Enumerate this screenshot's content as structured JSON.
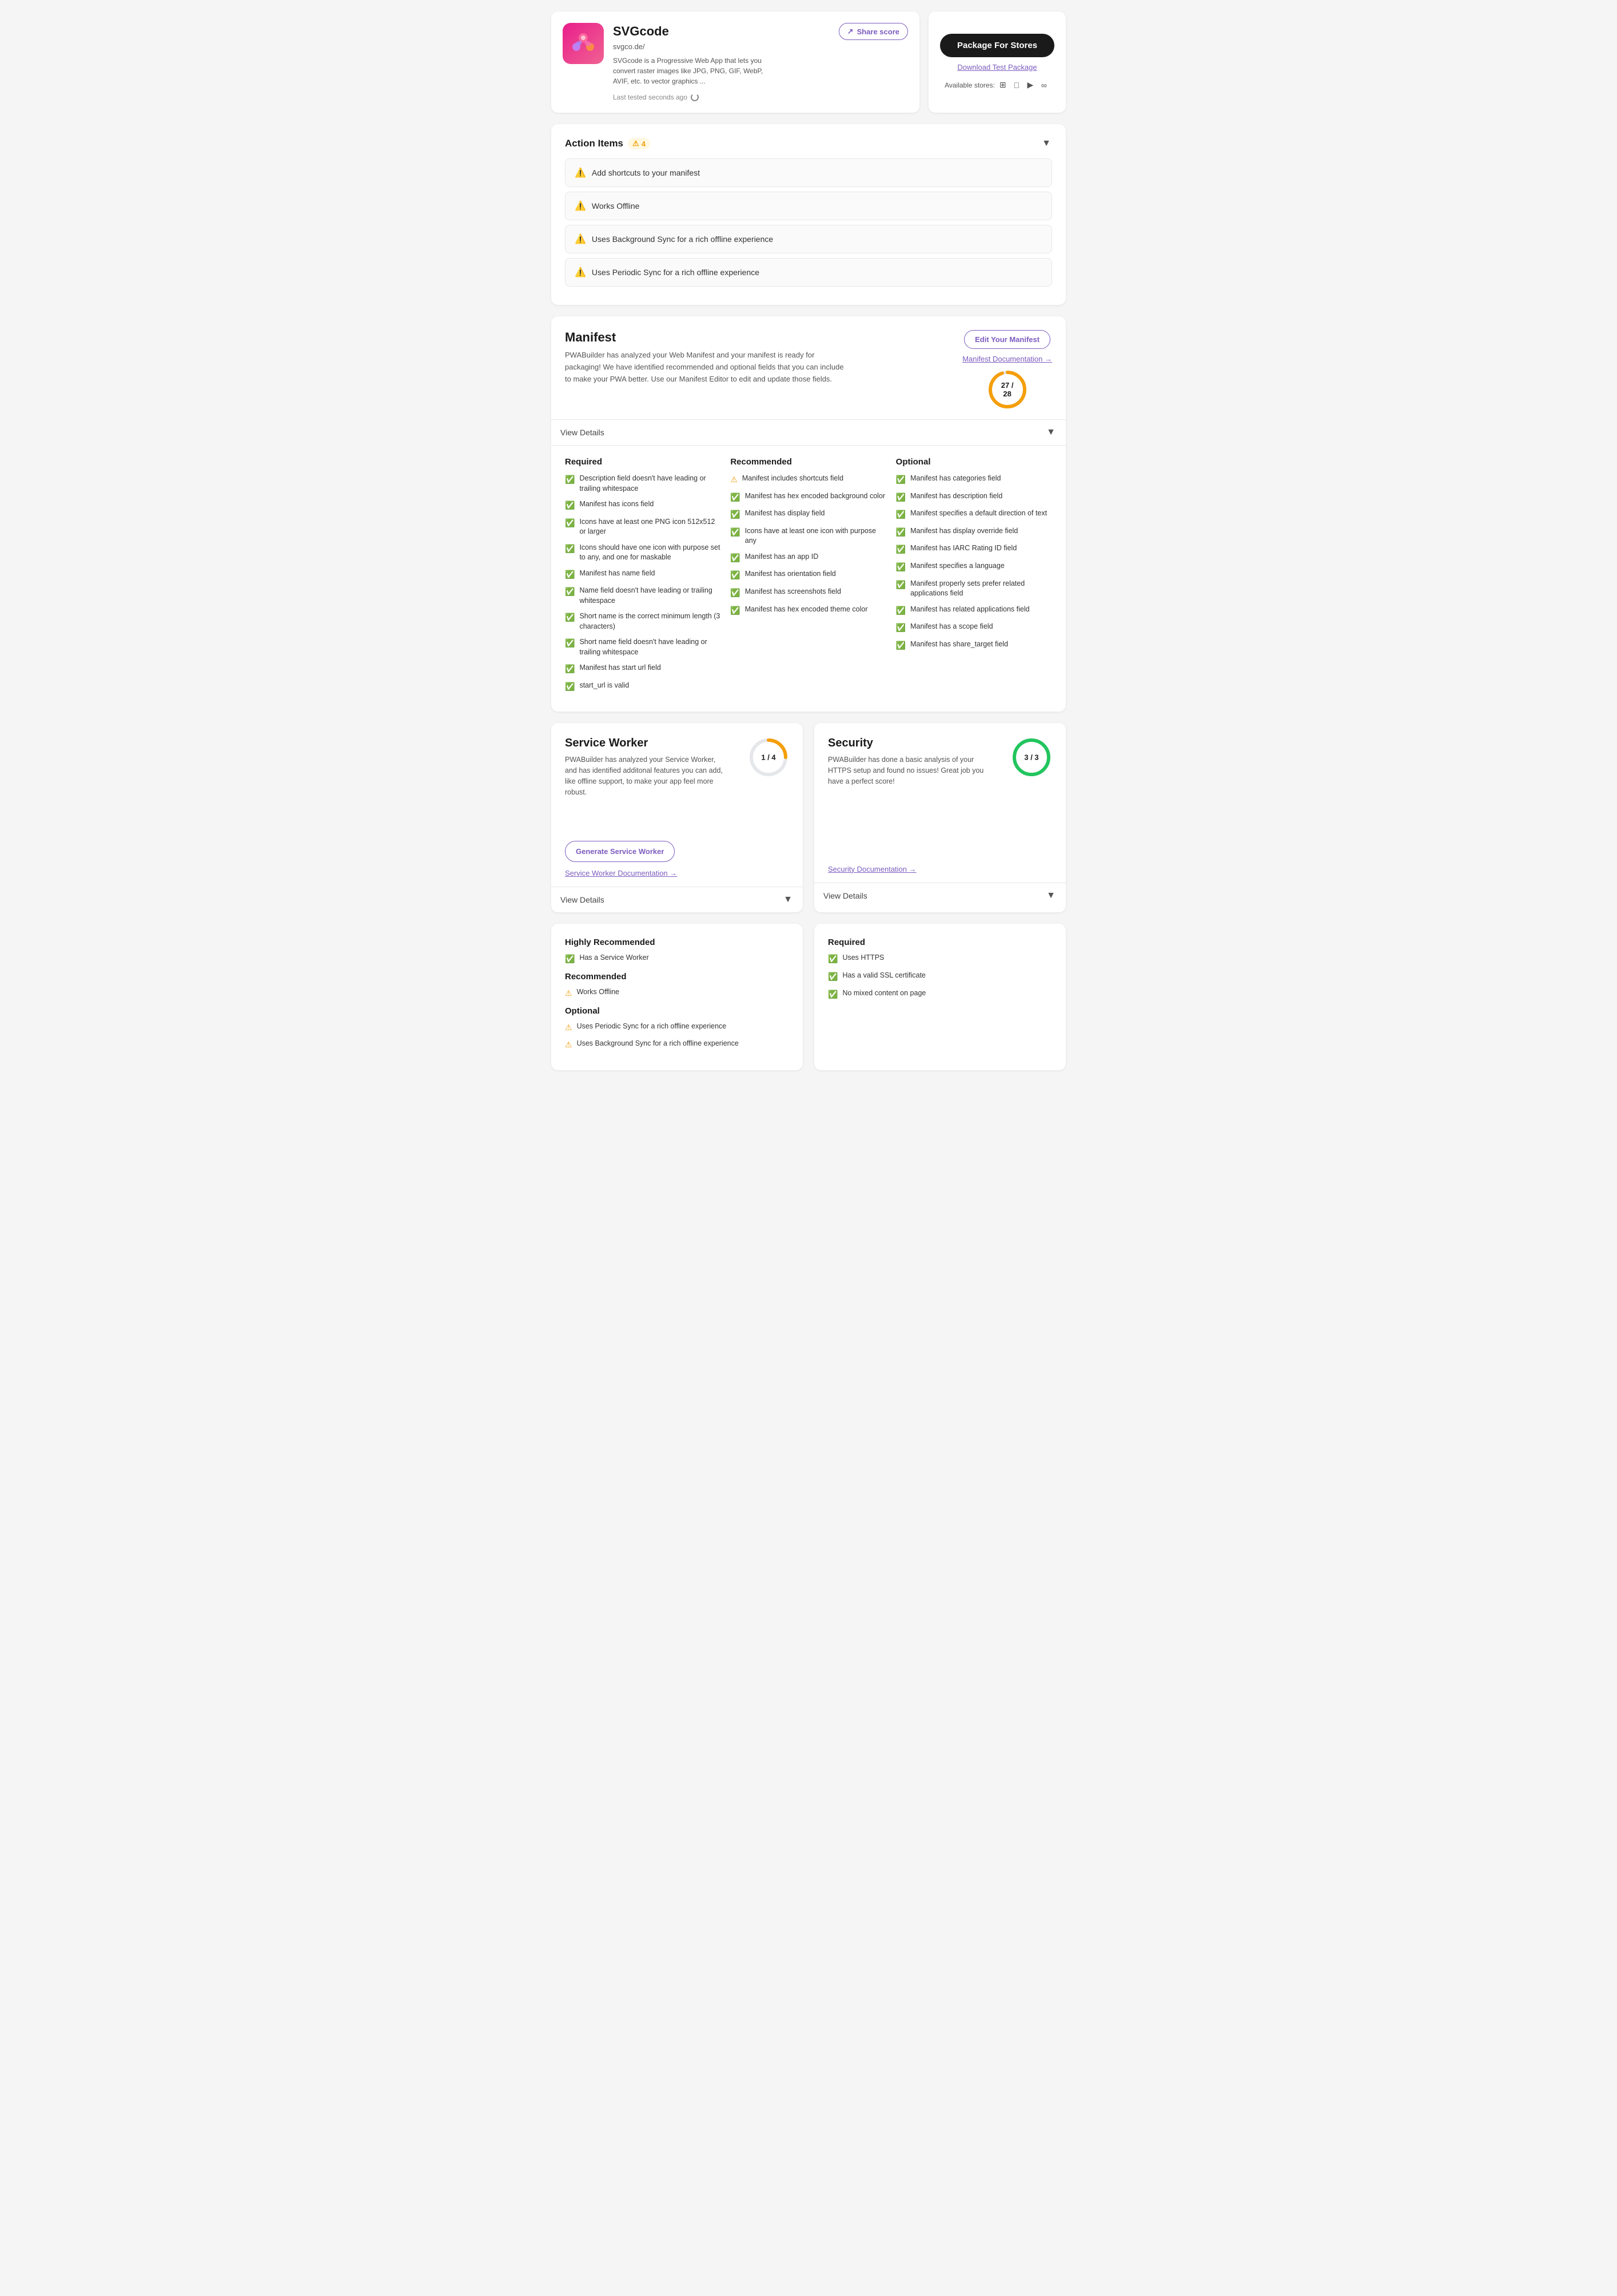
{
  "app": {
    "name": "SVGcode",
    "url": "svgco.de/",
    "description": "SVGcode is a Progressive Web App that lets you convert raster images like JPG, PNG, GIF, WebP, AVIF, etc. to vector graphics ...",
    "last_tested": "Last tested seconds ago"
  },
  "header": {
    "share_btn": "Share score",
    "package_btn": "Package For Stores",
    "download_test": "Download Test Package",
    "available_stores_label": "Available stores:"
  },
  "action_items": {
    "title": "Action Items",
    "count": "4",
    "items": [
      "Add shortcuts to your manifest",
      "Works Offline",
      "Uses Background Sync for a rich offline experience",
      "Uses Periodic Sync for a rich offline experience"
    ]
  },
  "manifest": {
    "title": "Manifest",
    "description": "PWABuilder has analyzed your Web Manifest and your manifest is ready for packaging! We have identified recommended and optional fields that you can include to make your PWA better. Use our Manifest Editor to edit and update those fields.",
    "edit_btn": "Edit Your Manifest",
    "doc_link": "Manifest Documentation →",
    "score": "27 / 28",
    "score_num": 27,
    "score_max": 28,
    "view_details": "View Details",
    "required": {
      "title": "Required",
      "items": [
        {
          "status": "check",
          "text": "Description field doesn't have leading or trailing whitespace"
        },
        {
          "status": "check",
          "text": "Manifest has icons field"
        },
        {
          "status": "check",
          "text": "Icons have at least one PNG icon 512x512 or larger"
        },
        {
          "status": "check",
          "text": "Icons should have one icon with purpose set to any, and one for maskable"
        },
        {
          "status": "check",
          "text": "Manifest has name field"
        },
        {
          "status": "check",
          "text": "Name field doesn't have leading or trailing whitespace"
        },
        {
          "status": "check",
          "text": "Short name is the correct minimum length (3 characters)"
        },
        {
          "status": "check",
          "text": "Short name field doesn't have leading or trailing whitespace"
        },
        {
          "status": "check",
          "text": "Manifest has start url field"
        },
        {
          "status": "check",
          "text": "start_url is valid"
        }
      ]
    },
    "recommended": {
      "title": "Recommended",
      "items": [
        {
          "status": "warn",
          "text": "Manifest includes shortcuts field"
        },
        {
          "status": "check",
          "text": "Manifest has hex encoded background color"
        },
        {
          "status": "check",
          "text": "Manifest has display field"
        },
        {
          "status": "check",
          "text": "Icons have at least one icon with purpose any"
        },
        {
          "status": "check",
          "text": "Manifest has an app ID"
        },
        {
          "status": "check",
          "text": "Manifest has orientation field"
        },
        {
          "status": "check",
          "text": "Manifest has screenshots field"
        },
        {
          "status": "check",
          "text": "Manifest has hex encoded theme color"
        }
      ]
    },
    "optional": {
      "title": "Optional",
      "items": [
        {
          "status": "check",
          "text": "Manifest has categories field"
        },
        {
          "status": "check",
          "text": "Manifest has description field"
        },
        {
          "status": "check",
          "text": "Manifest specifies a default direction of text"
        },
        {
          "status": "check",
          "text": "Manifest has display override field"
        },
        {
          "status": "check",
          "text": "Manifest has IARC Rating ID field"
        },
        {
          "status": "check",
          "text": "Manifest specifies a language"
        },
        {
          "status": "check",
          "text": "Manifest properly sets prefer related applications field"
        },
        {
          "status": "check",
          "text": "Manifest has related applications field"
        },
        {
          "status": "check",
          "text": "Manifest has a scope field"
        },
        {
          "status": "check",
          "text": "Manifest has share_target field"
        }
      ]
    }
  },
  "service_worker": {
    "title": "Service Worker",
    "description": "PWABuilder has analyzed your Service Worker, and has identified additonal features you can add, like offline support, to make your app feel more robust.",
    "score": "1 / 4",
    "score_num": 1,
    "score_max": 4,
    "gen_btn": "Generate Service Worker",
    "doc_link": "Service Worker Documentation →",
    "view_details": "View Details",
    "highly_recommended": {
      "title": "Highly Recommended",
      "items": [
        {
          "status": "check",
          "text": "Has a Service Worker"
        }
      ]
    },
    "recommended": {
      "title": "Recommended",
      "items": [
        {
          "status": "warn",
          "text": "Works Offline"
        }
      ]
    },
    "optional": {
      "title": "Optional",
      "items": [
        {
          "status": "warn",
          "text": "Uses Periodic Sync for a rich offline experience"
        },
        {
          "status": "warn",
          "text": "Uses Background Sync for a rich offline experience"
        }
      ]
    }
  },
  "security": {
    "title": "Security",
    "description": "PWABuilder has done a basic analysis of your HTTPS setup and found no issues! Great job you have a perfect score!",
    "score": "3 / 3",
    "score_num": 3,
    "score_max": 3,
    "doc_link": "Security Documentation →",
    "view_details": "View Details",
    "required": {
      "title": "Required",
      "items": [
        {
          "status": "check",
          "text": "Uses HTTPS"
        },
        {
          "status": "check",
          "text": "Has a valid SSL certificate"
        },
        {
          "status": "check",
          "text": "No mixed content on page"
        }
      ]
    }
  },
  "colors": {
    "purple": "#7c5cbf",
    "green": "#22c55e",
    "yellow": "#f59e0b",
    "dark": "#1a1a1a"
  }
}
